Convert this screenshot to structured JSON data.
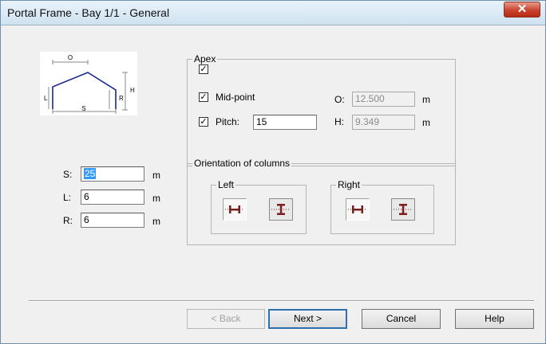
{
  "window": {
    "title": "Portal Frame - Bay 1/1 - General",
    "close_glyph": "✕"
  },
  "diagram": {
    "o_label": "O",
    "h_label": "H",
    "l_label": "L",
    "r_label": "R",
    "s_label": "S"
  },
  "apex": {
    "group_label": "Apex",
    "apex_checked": true,
    "midpoint_label": "Mid-point",
    "midpoint_checked": true,
    "pitch_label": "Pitch:",
    "pitch_checked": true,
    "pitch_value": "15",
    "o_label": "O:",
    "o_value": "12.500",
    "o_unit": "m",
    "h_label": "H:",
    "h_value": "9.349",
    "h_unit": "m",
    "check_glyph": "✓"
  },
  "dims": {
    "s_label": "S:",
    "s_value": "25",
    "s_unit": "m",
    "l_label": "L:",
    "l_value": "6",
    "l_unit": "m",
    "r_label": "R:",
    "r_value": "6",
    "r_unit": "m"
  },
  "orientation": {
    "group_label": "Orientation of columns",
    "left_label": "Left",
    "right_label": "Right",
    "icons": [
      "column-strong-axis-icon",
      "column-weak-axis-icon"
    ],
    "icon_color": "#7a1e1e"
  },
  "buttons": {
    "back": "< Back",
    "next": "Next >",
    "cancel": "Cancel",
    "help": "Help"
  }
}
